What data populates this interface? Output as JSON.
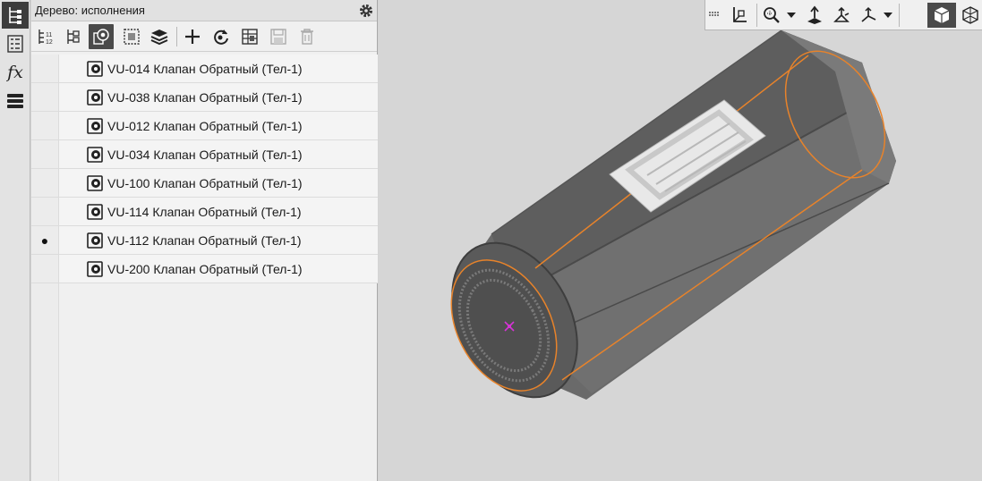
{
  "left_strip": {
    "icons": [
      "tree-icon",
      "properties-icon",
      "variables-fx-icon",
      "layers-icon"
    ],
    "fx_label": "fx"
  },
  "panel": {
    "title": "Дерево: исполнения",
    "toolbar_icons": [
      "sort-numbers-icon",
      "structure-tree-icon",
      "variants-icon",
      "select-area-icon",
      "layers-stack-icon",
      "add-variant-icon",
      "refresh-variant-icon",
      "table-icon",
      "save-icon",
      "delete-icon"
    ]
  },
  "variants": [
    {
      "label": "VU-014 Клапан Обратный (Тел-1)",
      "marker": ""
    },
    {
      "label": "VU-038 Клапан Обратный (Тел-1)",
      "marker": ""
    },
    {
      "label": "VU-012 Клапан Обратный (Тел-1)",
      "marker": ""
    },
    {
      "label": "VU-034 Клапан Обратный (Тел-1)",
      "marker": ""
    },
    {
      "label": "VU-100 Клапан Обратный (Тел-1)",
      "marker": ""
    },
    {
      "label": "VU-114 Клапан Обратный (Тел-1)",
      "marker": ""
    },
    {
      "label": "VU-112 Клапан Обратный (Тел-1)",
      "marker": "●"
    },
    {
      "label": "VU-200 Клапан Обратный (Тел-1)",
      "marker": ""
    }
  ],
  "viewport": {
    "toolbar_icons": [
      "grip-icon",
      "coordinate-system-icon",
      "zoom-icon",
      "dropdown-arrow-icon",
      "normal-view-icon",
      "orientation-icon",
      "axes-icon",
      "dropdown-arrow-icon",
      "shaded-view-icon",
      "wireframe-view-icon"
    ],
    "model": "valve-body-3d"
  },
  "colors": {
    "accent_orange": "#e8832a",
    "active_button": "#4a4a4a",
    "panel_bg": "#f0f0f0",
    "viewport_bg": "#d6d6d6"
  }
}
